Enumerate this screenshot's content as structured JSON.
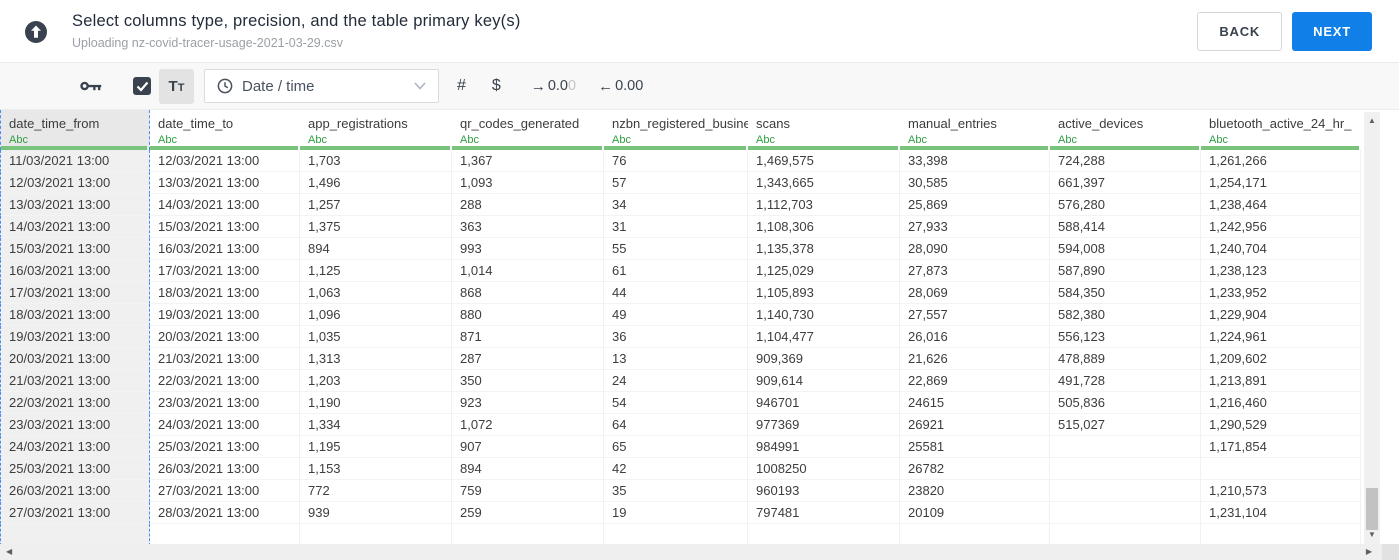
{
  "header": {
    "title": "Select columns type, precision, and the table primary key(s)",
    "subtitle": "Uploading nz-covid-tracer-usage-2021-03-29.csv",
    "back_label": "BACK",
    "next_label": "NEXT"
  },
  "toolbar": {
    "checkbox_checked": true,
    "text_type_label": "Tt",
    "type_select_value": "Date / time",
    "decimal_increase": {
      "arrow": "→",
      "dark": "0.0",
      "muted": "0"
    },
    "decimal_decrease": {
      "arrow": "←",
      "dark": "0.00",
      "muted": ""
    }
  },
  "icons": {
    "number_sign": "#",
    "dollar_sign": "$",
    "scroll_up": "▲",
    "scroll_down": "▼",
    "scroll_left": "◀",
    "scroll_right": "▶"
  },
  "table": {
    "selected_column": 0,
    "columns": [
      {
        "name": "date_time_from",
        "type": "Abc"
      },
      {
        "name": "date_time_to",
        "type": "Abc"
      },
      {
        "name": "app_registrations",
        "type": "Abc"
      },
      {
        "name": "qr_codes_generated",
        "type": "Abc"
      },
      {
        "name": "nzbn_registered_busine",
        "type": "Abc"
      },
      {
        "name": "scans",
        "type": "Abc"
      },
      {
        "name": "manual_entries",
        "type": "Abc"
      },
      {
        "name": "active_devices",
        "type": "Abc"
      },
      {
        "name": "bluetooth_active_24_hr_",
        "type": "Abc"
      }
    ],
    "rows": [
      [
        "11/03/2021 13:00",
        "12/03/2021 13:00",
        "1,703",
        "1,367",
        "76",
        "1,469,575",
        "33,398",
        "724,288",
        "1,261,266"
      ],
      [
        "12/03/2021 13:00",
        "13/03/2021 13:00",
        "1,496",
        "1,093",
        "57",
        "1,343,665",
        "30,585",
        "661,397",
        "1,254,171"
      ],
      [
        "13/03/2021 13:00",
        "14/03/2021 13:00",
        "1,257",
        "288",
        "34",
        "1,112,703",
        "25,869",
        "576,280",
        "1,238,464"
      ],
      [
        "14/03/2021 13:00",
        "15/03/2021 13:00",
        "1,375",
        "363",
        "31",
        "1,108,306",
        "27,933",
        "588,414",
        "1,242,956"
      ],
      [
        "15/03/2021 13:00",
        "16/03/2021 13:00",
        "894",
        "993",
        "55",
        "1,135,378",
        "28,090",
        "594,008",
        "1,240,704"
      ],
      [
        "16/03/2021 13:00",
        "17/03/2021 13:00",
        "1,125",
        "1,014",
        "61",
        "1,125,029",
        "27,873",
        "587,890",
        "1,238,123"
      ],
      [
        "17/03/2021 13:00",
        "18/03/2021 13:00",
        "1,063",
        "868",
        "44",
        "1,105,893",
        "28,069",
        "584,350",
        "1,233,952"
      ],
      [
        "18/03/2021 13:00",
        "19/03/2021 13:00",
        "1,096",
        "880",
        "49",
        "1,140,730",
        "27,557",
        "582,380",
        "1,229,904"
      ],
      [
        "19/03/2021 13:00",
        "20/03/2021 13:00",
        "1,035",
        "871",
        "36",
        "1,104,477",
        "26,016",
        "556,123",
        "1,224,961"
      ],
      [
        "20/03/2021 13:00",
        "21/03/2021 13:00",
        "1,313",
        "287",
        "13",
        "909,369",
        "21,626",
        "478,889",
        "1,209,602"
      ],
      [
        "21/03/2021 13:00",
        "22/03/2021 13:00",
        "1,203",
        "350",
        "24",
        "909,614",
        "22,869",
        "491,728",
        "1,213,891"
      ],
      [
        "22/03/2021 13:00",
        "23/03/2021 13:00",
        "1,190",
        "923",
        "54",
        "946701",
        "24615",
        "505,836",
        "1,216,460"
      ],
      [
        "23/03/2021 13:00",
        "24/03/2021 13:00",
        "1,334",
        "1,072",
        "64",
        "977369",
        "26921",
        "515,027",
        "1,290,529"
      ],
      [
        "24/03/2021 13:00",
        "25/03/2021 13:00",
        "1,195",
        "907",
        "65",
        "984991",
        "25581",
        "",
        "1,171,854"
      ],
      [
        "25/03/2021 13:00",
        "26/03/2021 13:00",
        "1,153",
        "894",
        "42",
        "1008250",
        "26782",
        "",
        ""
      ],
      [
        "26/03/2021 13:00",
        "27/03/2021 13:00",
        "772",
        "759",
        "35",
        "960193",
        "23820",
        "",
        "1,210,573"
      ],
      [
        "27/03/2021 13:00",
        "28/03/2021 13:00",
        "939",
        "259",
        "19",
        "797481",
        "20109",
        "",
        "1,231,104"
      ]
    ]
  },
  "colors": {
    "accent_blue": "#1080e8",
    "type_green": "#2f9e41",
    "header_bar_green": "#79c47c",
    "selection_blue": "#4a8cf7",
    "dark_navy": "#39424e"
  }
}
